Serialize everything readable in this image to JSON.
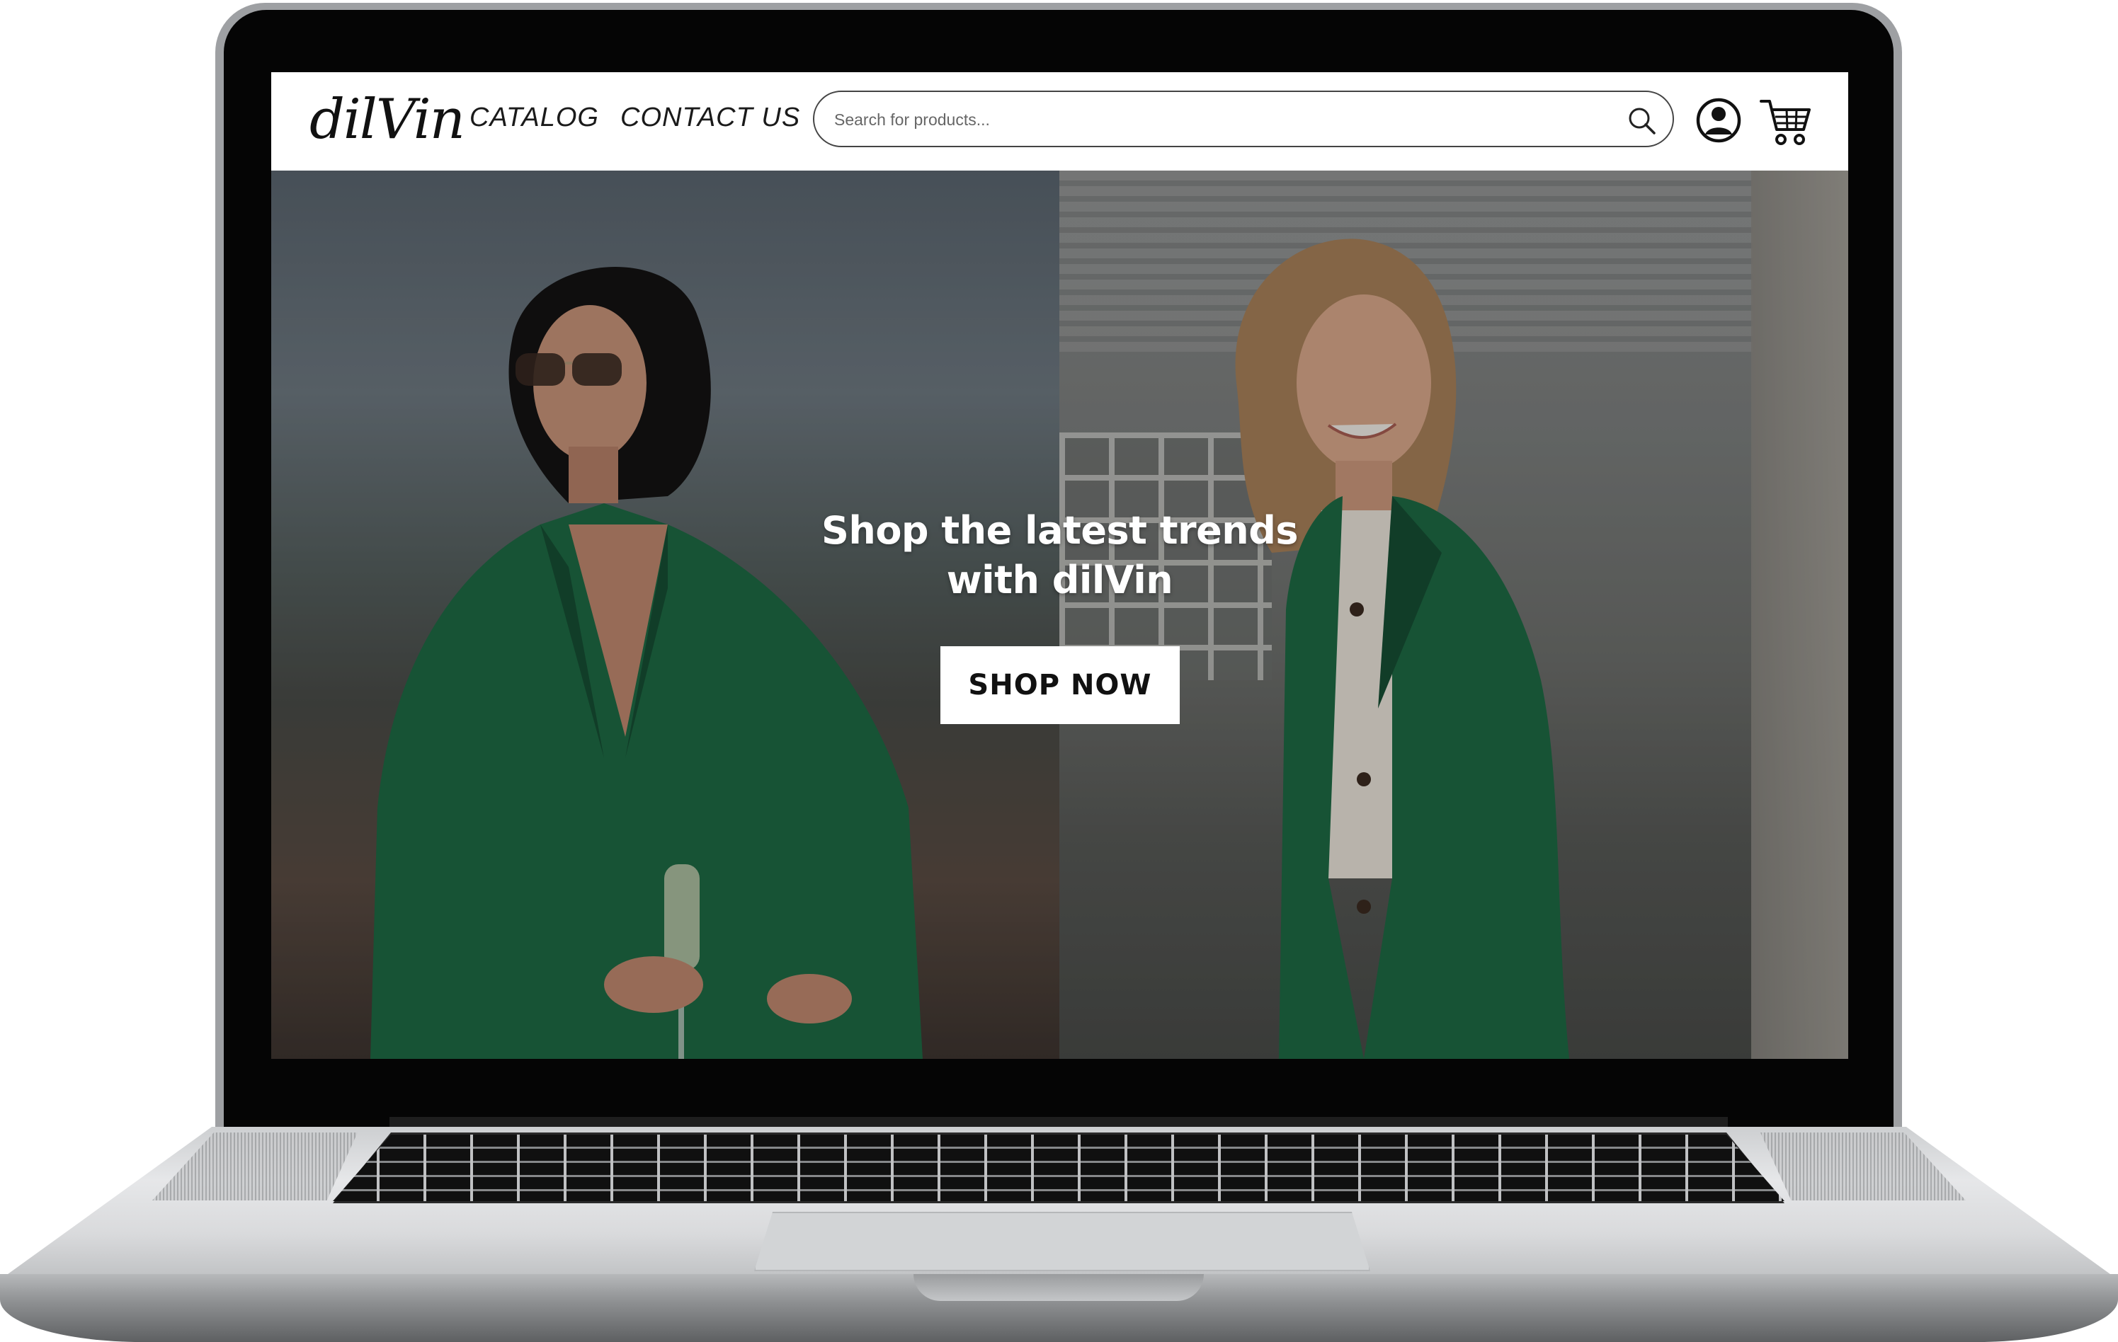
{
  "site": {
    "logo": "dilVin",
    "nav": [
      {
        "label": "CATALOG"
      },
      {
        "label": "CONTACT US"
      }
    ],
    "search": {
      "placeholder": "Search for products..."
    },
    "icons": {
      "search": "search-icon",
      "account": "user-circle-icon",
      "cart": "cart-icon"
    }
  },
  "hero": {
    "title_line1": "Shop the latest trends",
    "title_line2": "with dilVin",
    "cta_label": "SHOP NOW"
  },
  "colors": {
    "jacket_green": "#1e6b45",
    "header_bg": "#ffffff",
    "button_bg": "#ffffff",
    "title_text": "#ffffff"
  }
}
